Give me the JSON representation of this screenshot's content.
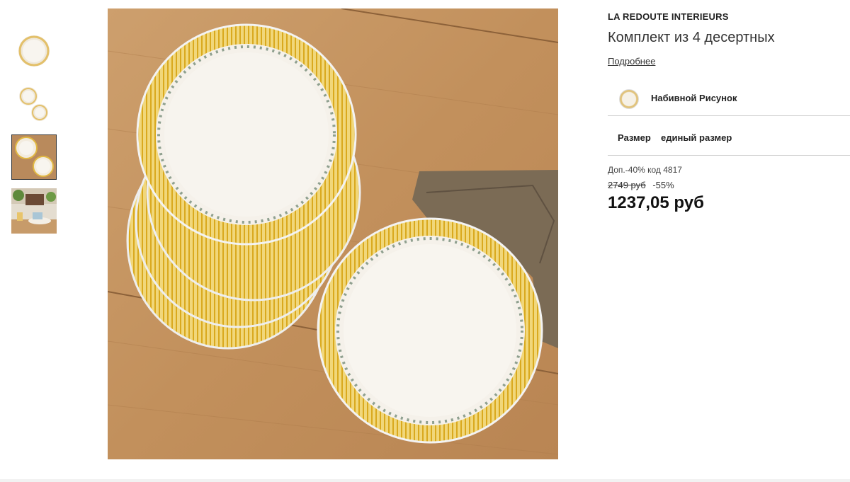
{
  "gallery": {
    "thumbnails": [
      {
        "alt": "plate-single"
      },
      {
        "alt": "plates-two"
      },
      {
        "alt": "plates-stack",
        "selected": true
      },
      {
        "alt": "table-scene"
      }
    ]
  },
  "product": {
    "brand": "LA REDOUTE INTERIEURS",
    "title": "Комплект из 4 десертных",
    "more_link": "Подробнее",
    "color": {
      "label": "Набивной Рисунок"
    },
    "size": {
      "label": "Размер",
      "value": "единый размер"
    },
    "promo": "Доп.-40% код 4817",
    "old_price": "2749 руб",
    "discount": "-55%",
    "price": "1237,05 руб"
  },
  "colors": {
    "wood": "#c49563",
    "plate": "#f5f1ea",
    "rim": "#e2b83a",
    "napkin": "#7a6a54"
  }
}
